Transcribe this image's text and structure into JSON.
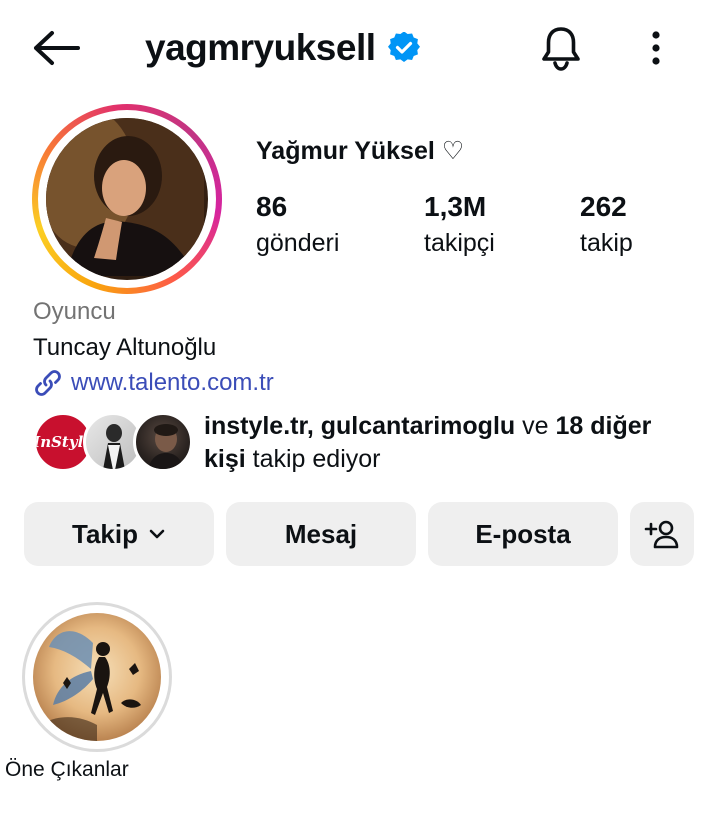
{
  "header": {
    "username": "yagmryuksell",
    "back_icon": "arrow-left-icon",
    "verified_icon": "verified-badge-icon",
    "bell_icon": "bell-icon",
    "more_icon": "more-vertical-icon"
  },
  "profile": {
    "full_name": "Yağmur Yüksel ♡",
    "stats": {
      "posts": {
        "value": "86",
        "label": "gönderi"
      },
      "followers": {
        "value": "1,3M",
        "label": "takipçi"
      },
      "following": {
        "value": "262",
        "label": "takip"
      }
    },
    "category": "Oyuncu",
    "bio": "Tuncay Altunoğlu",
    "link": "www.talento.com.tr"
  },
  "followed_by": {
    "avatar1_text": "InStyle",
    "names": "instyle.tr, gulcantarimoglu",
    "connector": " ve ",
    "others": "18 diğer kişi",
    "suffix": " takip ediyor"
  },
  "actions": {
    "follow": "Takip",
    "message": "Mesaj",
    "email": "E-posta"
  },
  "highlights": [
    {
      "label": "Öne Çıkanlar"
    }
  ],
  "colors": {
    "verified": "#0095f6",
    "link": "#3b4db8",
    "button_bg": "#efefef",
    "secondary_text": "#737373"
  }
}
